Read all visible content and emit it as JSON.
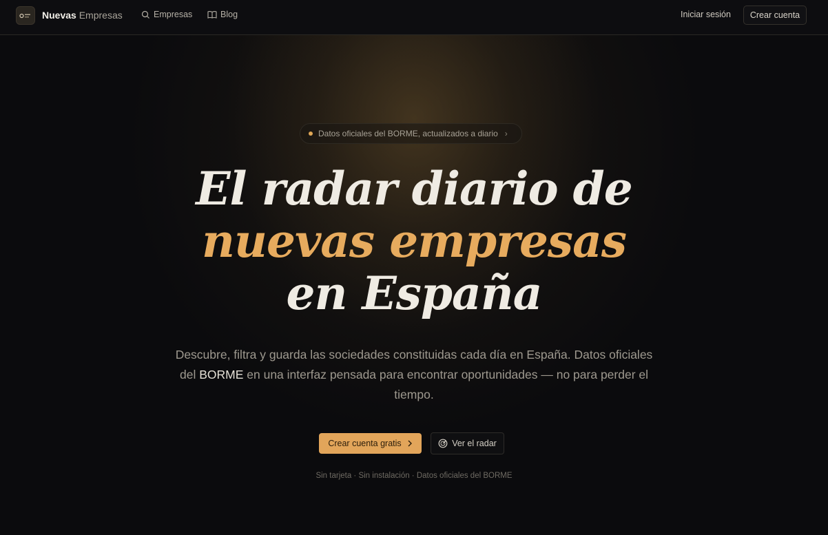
{
  "header": {
    "brand_bold": "Nuevas",
    "brand_light": "Empresas",
    "nav": [
      {
        "label": "Empresas",
        "icon": "search-icon"
      },
      {
        "label": "Blog",
        "icon": "book-icon"
      }
    ],
    "login_label": "Iniciar sesión",
    "signup_label": "Crear cuenta"
  },
  "hero": {
    "pill_text": "Datos oficiales del BORME, actualizados a diario",
    "headline_line1": "El radar diario de",
    "headline_line2": "nuevas empresas",
    "headline_line3": "en España",
    "sub_part1": "Descubre, filtra y guarda las sociedades constituidas cada día en España. Datos oficiales del ",
    "sub_highlight": "BORME",
    "sub_part2": " en una interfaz pensada para encontrar oportunidades — no para perder el tiempo.",
    "cta_primary": "Crear cuenta gratis",
    "cta_secondary": "Ver el radar",
    "footnote": "Sin tarjeta · Sin instalación · Datos oficiales del BORME"
  },
  "colors": {
    "accent": "#e7ab5e",
    "background": "#0b0b0d",
    "primary_button": "#e2a55a"
  }
}
